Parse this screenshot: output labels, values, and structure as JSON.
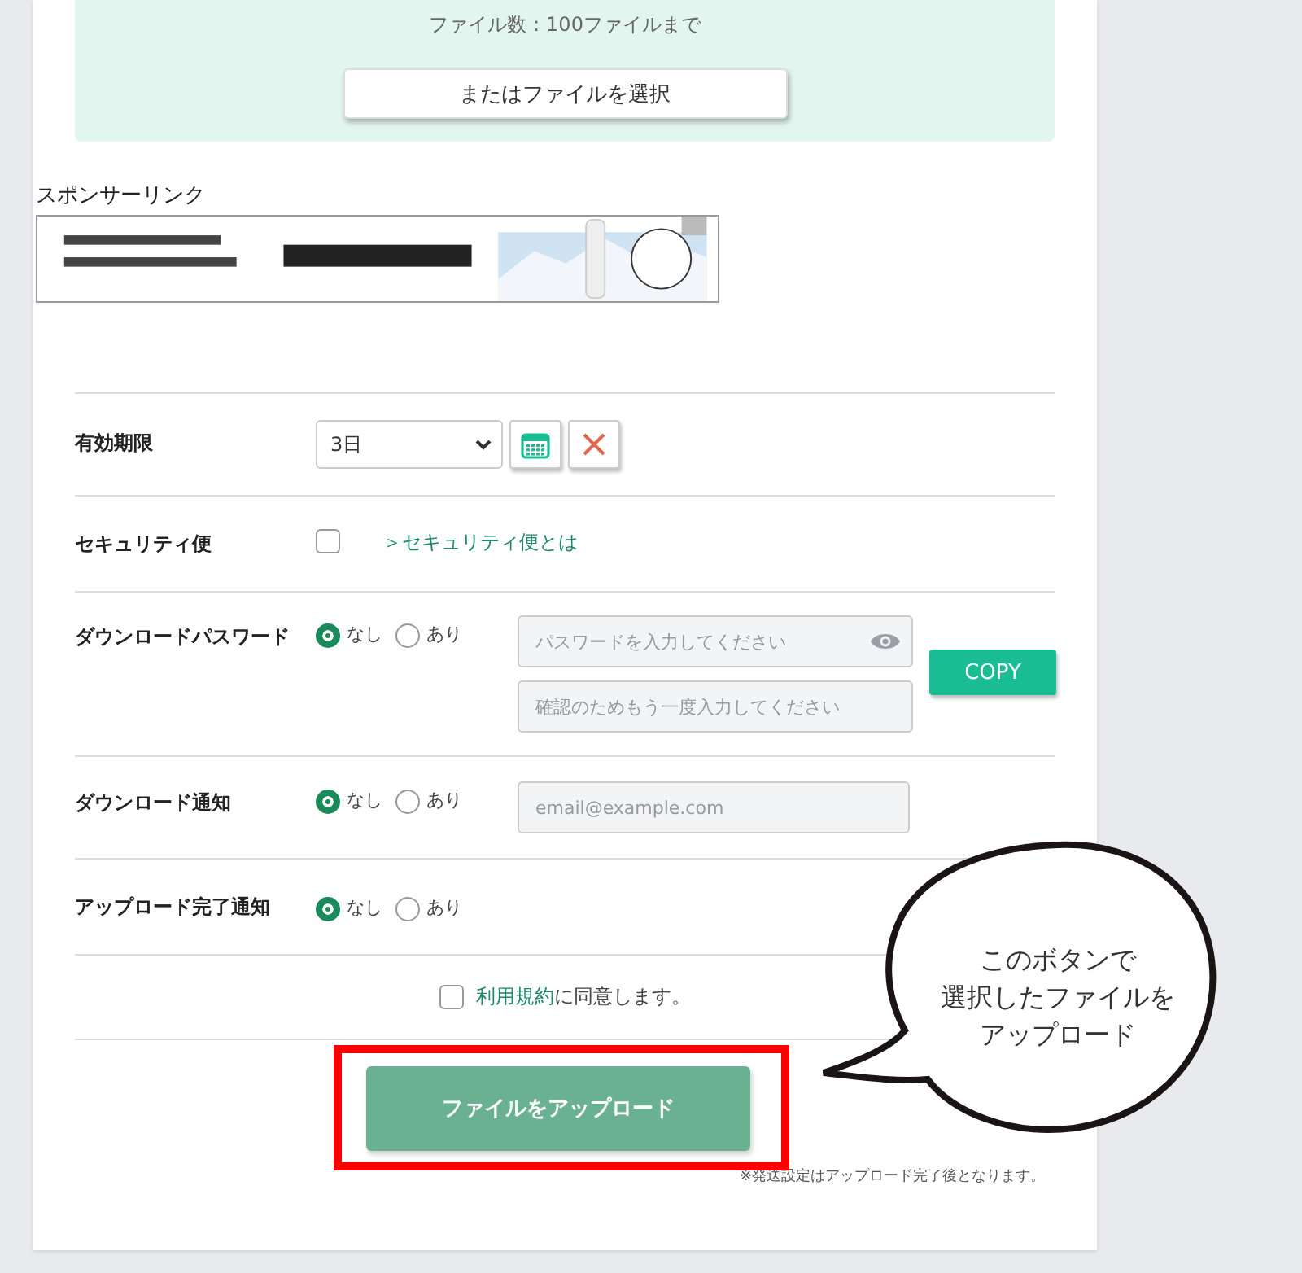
{
  "upload_area": {
    "note": "ファイル数：100ファイルまで",
    "button": "またはファイルを選択"
  },
  "sponsor": {
    "label": "スポンサーリンク"
  },
  "settings": [
    {
      "kind": "select",
      "label": "有効期限",
      "value": "3日"
    },
    {
      "kind": "checkbox",
      "label": "セキュリティ便",
      "checked": false,
      "link": "＞セキュリティ便とは"
    },
    {
      "kind": "password",
      "label": "ダウンロードパスワード",
      "options": [
        {
          "label": "なし",
          "selected": true
        },
        {
          "label": "あり",
          "selected": false
        }
      ],
      "placeholders": [
        "パスワードを入力してください",
        "確認のためもう一度入力してください"
      ],
      "button": "COPY"
    },
    {
      "kind": "email",
      "label": "ダウンロード通知",
      "options": [
        {
          "label": "なし",
          "selected": true
        },
        {
          "label": "あり",
          "selected": false
        }
      ],
      "placeholder": "email@example.com"
    },
    {
      "kind": "radio",
      "label": "アップロード完了通知",
      "options": [
        {
          "label": "なし",
          "selected": true
        },
        {
          "label": "あり",
          "selected": false
        }
      ]
    }
  ],
  "terms": {
    "checked": false,
    "link": "利用規約",
    "text": "に同意します。"
  },
  "upload_button": "ファイルをアップロード",
  "footnote": "※発送設定はアップロード完了後となります。",
  "callout": {
    "lines": [
      "このボタンで",
      "選択したファイルを",
      "アップロード"
    ]
  }
}
